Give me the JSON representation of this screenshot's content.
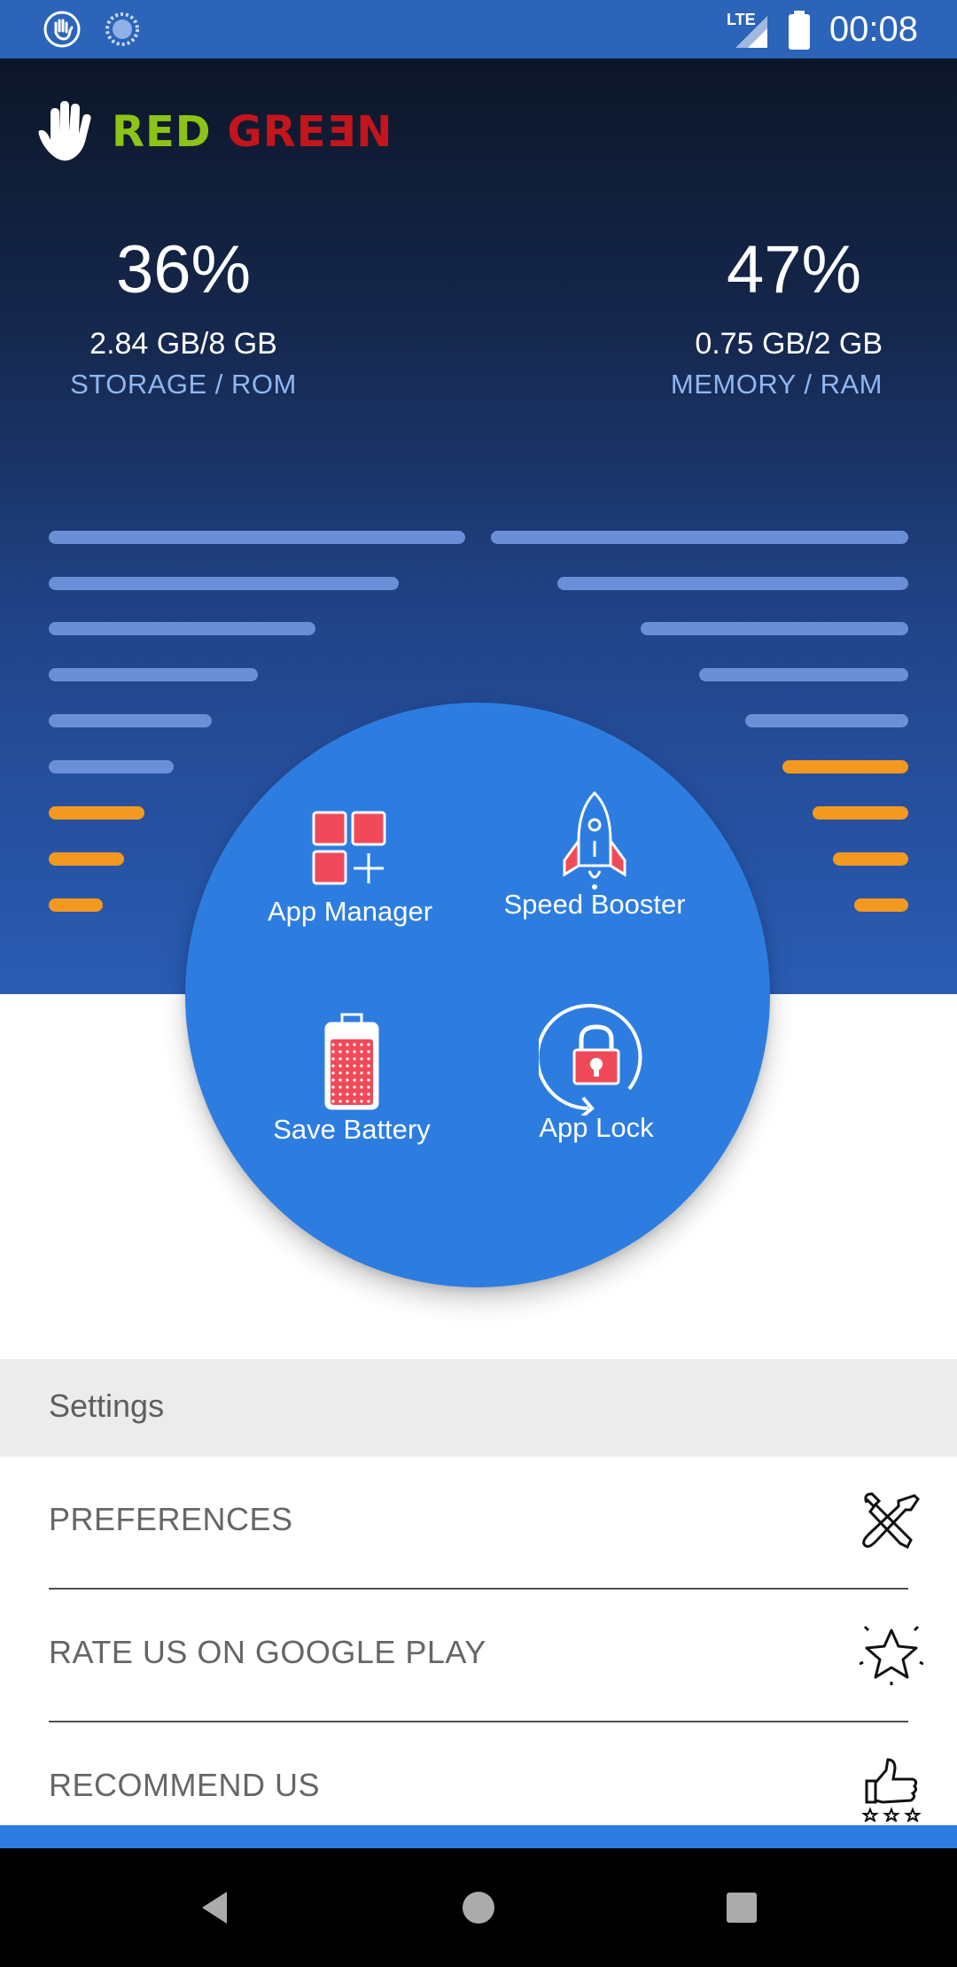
{
  "status_bar": {
    "time": "00:08",
    "icons": [
      "hand-notification-icon",
      "loading-notification-icon",
      "lte-signal-icon",
      "battery-icon"
    ],
    "network": "LTE"
  },
  "app": {
    "logo_red": "RED",
    "logo_green": "GREƎN",
    "colors": {
      "hero_top": "#0d1628",
      "hero_bottom": "#2a5cb4",
      "accent": "#2d7de1",
      "bar_blue": "#6a8fd6",
      "bar_orange": "#f4991f",
      "logo_red_word": "#8bc417",
      "logo_green_word": "#c3151b"
    }
  },
  "storage": {
    "percent": "36%",
    "amount": "2.84 GB/8 GB",
    "label": "STORAGE / ROM",
    "fill_fraction": 0.36
  },
  "memory": {
    "percent": "47%",
    "amount": "0.75 GB/2 GB",
    "label": "MEMORY / RAM",
    "fill_fraction": 0.47
  },
  "actions": [
    {
      "label": "App Manager",
      "icon": "app-grid-icon"
    },
    {
      "label": "Speed Booster",
      "icon": "rocket-icon"
    },
    {
      "label": "Save Battery",
      "icon": "battery-save-icon"
    },
    {
      "label": "App Lock",
      "icon": "lock-icon"
    }
  ],
  "settings": {
    "header": "Settings",
    "items": [
      {
        "label": "PREFERENCES",
        "icon": "tools-icon"
      },
      {
        "label": "RATE US ON GOOGLE PLAY",
        "icon": "star-icon"
      },
      {
        "label": "RECOMMEND US",
        "icon": "thumbs-up-icon"
      }
    ]
  },
  "nav": {
    "icons": [
      "back-icon",
      "home-icon",
      "recents-icon"
    ]
  }
}
